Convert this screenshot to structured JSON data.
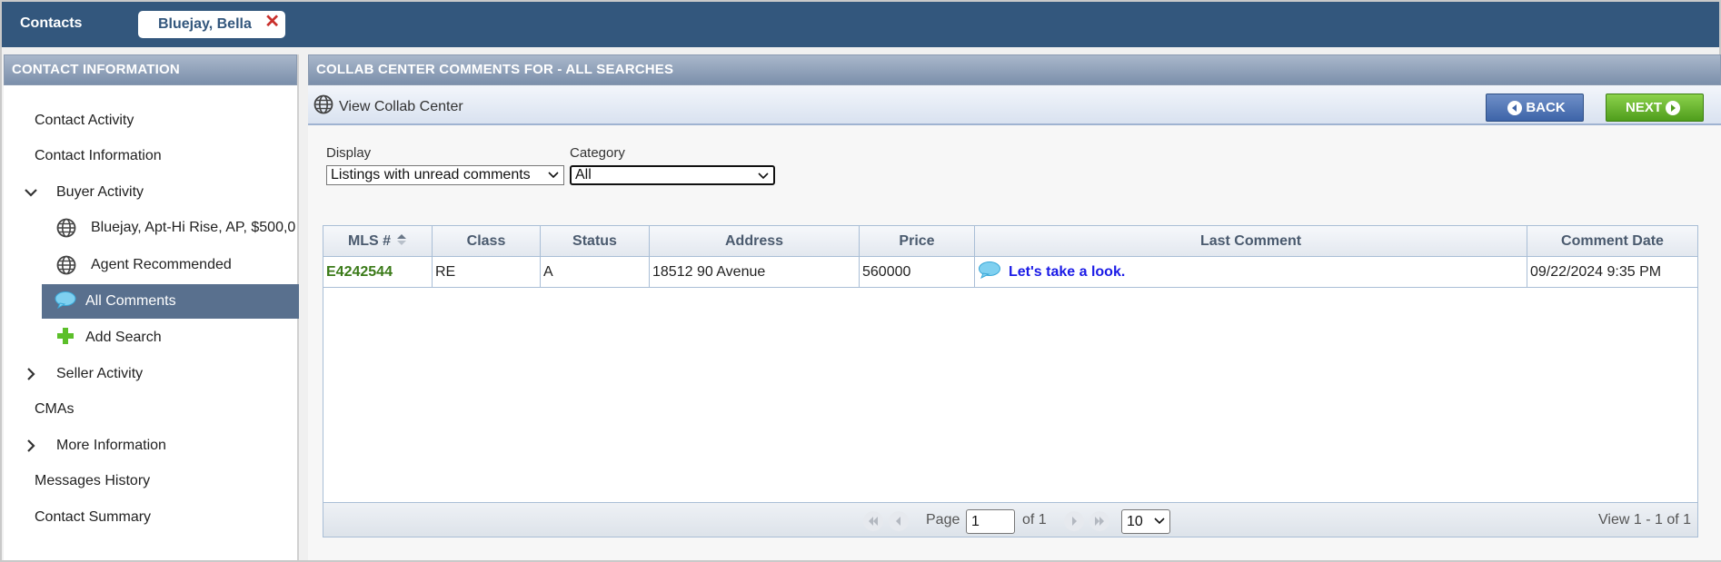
{
  "header": {
    "app_title": "Contacts",
    "contact_tab": "Bluejay, Bella",
    "close_glyph": "✕"
  },
  "sidebar": {
    "title": "CONTACT INFORMATION",
    "items": [
      {
        "label": "Contact Activity"
      },
      {
        "label": "Contact Information"
      },
      {
        "label": "Buyer Activity"
      },
      {
        "label": "Bluejay, Apt-Hi Rise, AP, $500,0"
      },
      {
        "label": "Agent Recommended"
      },
      {
        "label": "All Comments"
      },
      {
        "label": "Add Search"
      },
      {
        "label": "Seller Activity"
      },
      {
        "label": "CMAs"
      },
      {
        "label": "More Information"
      },
      {
        "label": "Messages History"
      },
      {
        "label": "Contact Summary"
      }
    ]
  },
  "main": {
    "title": "COLLAB CENTER COMMENTS FOR - ALL SEARCHES",
    "view_collab_label": "View Collab Center",
    "back_label": "BACK",
    "next_label": "NEXT",
    "display_label": "Display",
    "display_value": "Listings with unread comments",
    "category_label": "Category",
    "category_value": "All"
  },
  "table": {
    "columns": [
      "MLS #",
      "Class",
      "Status",
      "Address",
      "Price",
      "Last Comment",
      "Comment Date"
    ],
    "rows": [
      {
        "mls": "E4242544",
        "class": "RE",
        "status": "A",
        "address": "18512 90 Avenue",
        "price": "560000",
        "last_comment": "Let's take a look.",
        "comment_date": "09/22/2024 9:35 PM"
      }
    ]
  },
  "pager": {
    "page_label": "Page",
    "page_value": "1",
    "of_label": "of 1",
    "rows_value": "10",
    "view_text": "View 1 - 1 of 1"
  },
  "colors": {
    "topbar": "#33577d",
    "selected_nav": "#59708e",
    "mls_link": "#3a7a18",
    "comment_link": "#1a1ae6",
    "next_button": "#5aaa22",
    "back_button": "#4a6fb0"
  }
}
